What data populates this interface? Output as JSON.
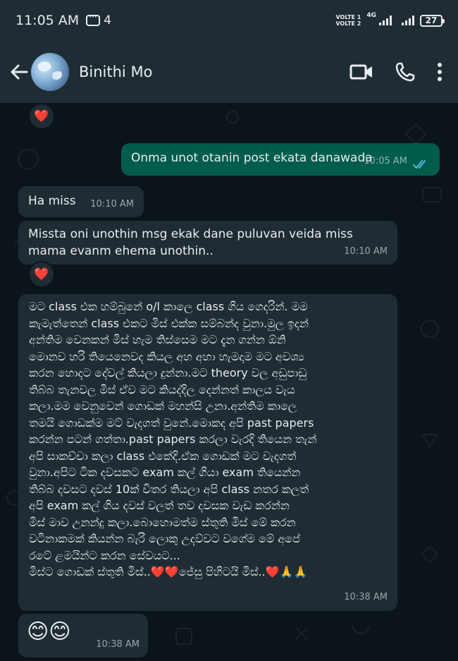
{
  "status_bar": {
    "time": "11:05 AM",
    "notification_count": "4",
    "volte_1": "VOLTE 1",
    "volte_2": "VOLTE 2",
    "network": "4G",
    "battery": "27"
  },
  "header": {
    "contact_name": "Binithi Mo",
    "icons": [
      "back-arrow-icon",
      "video-call-icon",
      "voice-call-icon",
      "more-options-icon"
    ]
  },
  "messages": [
    {
      "id": "m1",
      "direction": "out",
      "text": "Onma unot otanin post ekata danawada",
      "time": "10:05 AM",
      "status": "read"
    },
    {
      "id": "m2",
      "direction": "in",
      "text": "Ha miss",
      "time": "10:10 AM"
    },
    {
      "id": "m3",
      "direction": "in",
      "text": "Missta oni unothin msg ekak dane puluvan veida miss mama evanm ehema unothin..",
      "time": "10:10 AM",
      "reaction": "❤️"
    },
    {
      "id": "m4",
      "direction": "in",
      "lines": [
        "මට class එක හම්බුනේ o/l කාලෙ class ගිය ගෙදරින්. මම",
        "කැමැත්තෙන් class එකට මිස් එක්ක සම්බන්ද වුනා.මුල ඉදන්",
        "අන්තිම වෙනකන් මිස් හැම තිස්සෙම මට දැන ගන්න ඕනි",
        "මොනව හරි තියෙනෙවද කියල අහ අහා හැමදාම මට අවශ්‍ය",
        "කරන හොදට දේවල් කියලා දුන්නා.මට theory වල අඩුපාඩු",
        "තිබ්බ තැනවල මිස් ඒව මට කියද්දිල දෙන්නත් කාලය වැය",
        "කලා.මම වෙනුවෙන් ගොඩක් මහන්සි උනා.අන්තිම කාලෙ",
        "තමයි ගොඩක්ම මට් වැදගත් වුනේ.මොකද අපි past papers",
        "කරන්න පටන් ගත්තා.past papers කරලා වැරදි තියෙන තැන්",
        "අපි සාකච්චා කලා class එකේදි.ඒක ගොඩක් මට වැදගත්",
        "වුනා.අපිට ටික දවසකට exam කල් ගියා exam තියෙන්න",
        "තිබ්බ දවසට දවස් 10ක් විතර තියලා අපි class නතර කලත්",
        "අපි exam කල් ගිය දවස් වලත් තව දවසක වැඩ කරන්න",
        "මිස් මාව උනන්දු කලා.බොහොමත්ම ස්තුති මිස් මේ කරන",
        "වටිනාකමක් කියන්න බැරි ලොකු උදව්වට වගේම මේ අපේ",
        "රටේ ළමයින්ට කරන සේවයට...",
        "මිස්ට ගොඩක් ස්තුති මිස්..❤️❤️ජේසු පිහිටයි මිස්..❤️🙏🙏"
      ],
      "time": "10:38 AM"
    },
    {
      "id": "m5",
      "direction": "in",
      "text": "😊😊",
      "time": "10:38 AM"
    }
  ],
  "top_reaction": "❤️",
  "colors": {
    "chat_background": "#0b141a",
    "header_background": "#1f2c34",
    "incoming_bubble": "#1f2c34",
    "outgoing_bubble": "#005c4b",
    "read_ticks": "#53bdeb"
  }
}
